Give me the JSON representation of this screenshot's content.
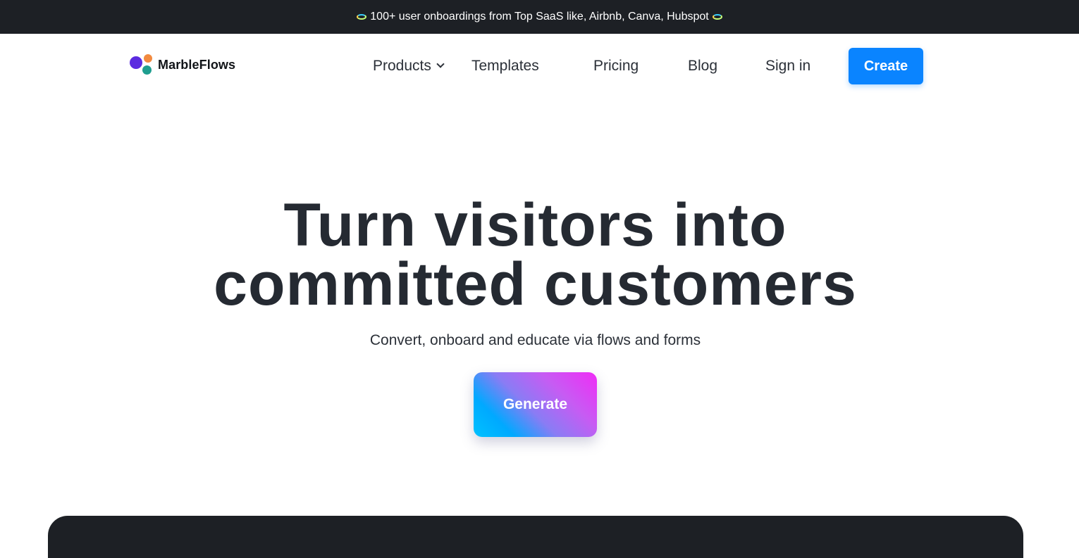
{
  "announcement": {
    "icon_left": "ring-icon",
    "text": "100+ user onboardings from Top SaaS like, Airbnb, Canva, Hubspot",
    "icon_right": "ring-icon"
  },
  "nav": {
    "logo_text": "MarbleFlows",
    "items": [
      {
        "label": "Products",
        "has_dropdown": true
      },
      {
        "label": "Templates"
      },
      {
        "label": "Pricing"
      },
      {
        "label": "Blog"
      },
      {
        "label": "Sign in"
      }
    ],
    "cta_label": "Create"
  },
  "hero": {
    "title_line1": "Turn visitors into",
    "title_line2": "committed customers",
    "subtitle": "Convert, onboard and educate via flows and forms",
    "button_label": "Generate"
  },
  "colors": {
    "topbar_bg": "#1d2025",
    "accent": "#0a84ff",
    "heading": "#252a32",
    "gradient_start": "#00c2ff",
    "gradient_end": "#f02cf6"
  }
}
